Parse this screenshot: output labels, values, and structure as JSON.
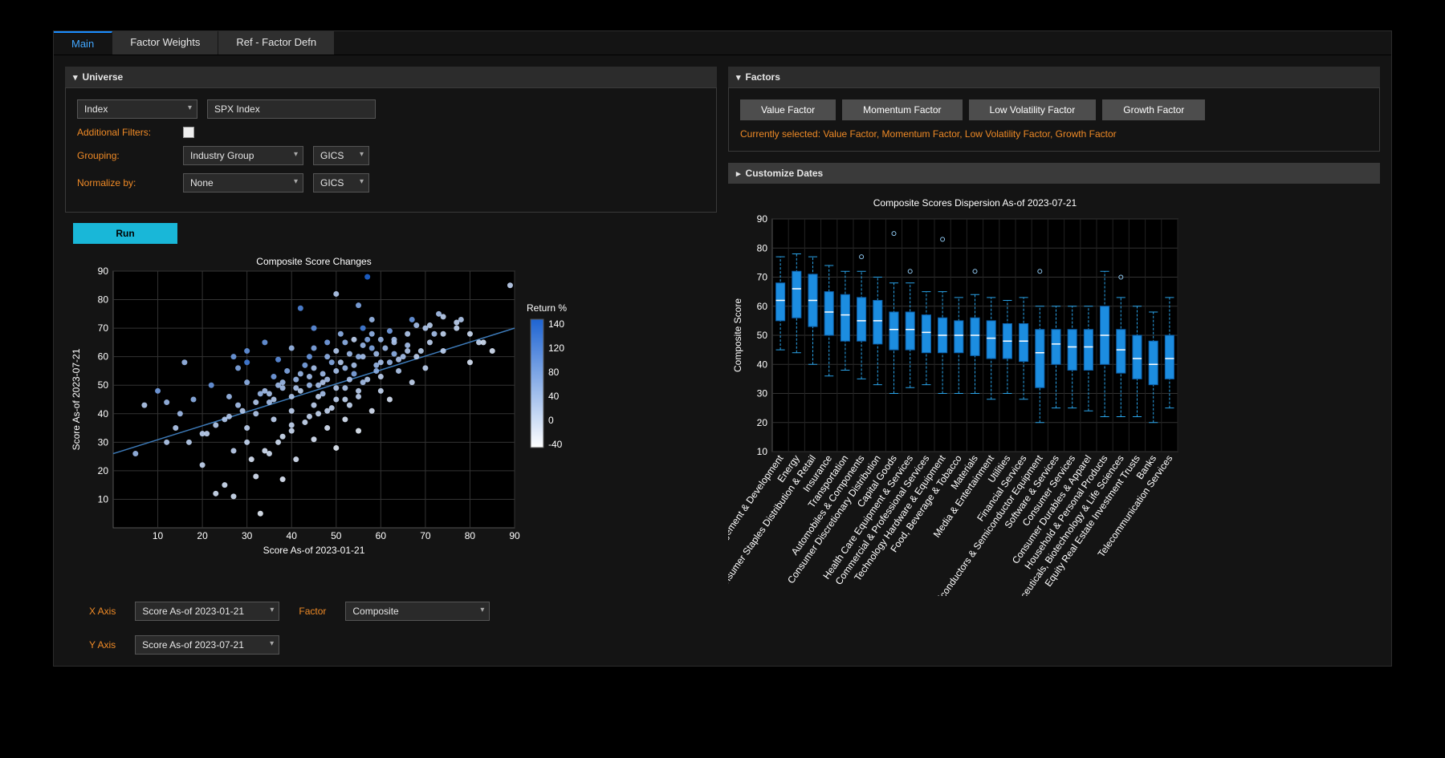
{
  "tabs": [
    "Main",
    "Factor Weights",
    "Ref - Factor Defn"
  ],
  "active_tab": 0,
  "universe": {
    "title": "Universe",
    "index_label": "Index",
    "index_value": "SPX Index",
    "additional_filters_label": "Additional Filters:",
    "grouping_label": "Grouping:",
    "grouping_value": "Industry Group",
    "grouping_system": "GICS",
    "normalize_label": "Normalize by:",
    "normalize_value": "None",
    "normalize_system": "GICS"
  },
  "run_label": "Run",
  "factors": {
    "title": "Factors",
    "buttons": [
      "Value Factor",
      "Momentum Factor",
      "Low Volatility Factor",
      "Growth Factor"
    ],
    "selected_text": "Currently selected: Value Factor, Momentum Factor, Low Volatility Factor, Growth Factor"
  },
  "customize_dates_title": "Customize Dates",
  "axis_controls": {
    "x_label": "X Axis",
    "x_value": "Score As-of 2023-01-21",
    "y_label": "Y Axis",
    "y_value": "Score As-of 2023-07-21",
    "factor_label": "Factor",
    "factor_value": "Composite"
  },
  "chart_data": [
    {
      "type": "scatter",
      "title": "Composite Score Changes",
      "xlabel": "Score As-of 2023-01-21",
      "ylabel": "Score As-of 2023-07-21",
      "xlim": [
        0,
        90
      ],
      "ylim": [
        0,
        90
      ],
      "color_legend_title": "Return %",
      "color_min": -40,
      "color_max": 140,
      "trend_line": [
        [
          0,
          26
        ],
        [
          90,
          70
        ]
      ],
      "points": [
        [
          57,
          88,
          140
        ],
        [
          89,
          85,
          10
        ],
        [
          50,
          82,
          20
        ],
        [
          42,
          77,
          100
        ],
        [
          55,
          78,
          60
        ],
        [
          73,
          75,
          30
        ],
        [
          67,
          73,
          80
        ],
        [
          58,
          73,
          40
        ],
        [
          78,
          73,
          20
        ],
        [
          68,
          71,
          30
        ],
        [
          56,
          70,
          110
        ],
        [
          70,
          70,
          20
        ],
        [
          77,
          72,
          10
        ],
        [
          62,
          69,
          70
        ],
        [
          45,
          70,
          90
        ],
        [
          51,
          68,
          50
        ],
        [
          72,
          68,
          30
        ],
        [
          60,
          66,
          40
        ],
        [
          82,
          65,
          5
        ],
        [
          54,
          66,
          10
        ],
        [
          48,
          65,
          70
        ],
        [
          66,
          64,
          30
        ],
        [
          58,
          63,
          60
        ],
        [
          40,
          63,
          40
        ],
        [
          74,
          62,
          10
        ],
        [
          50,
          62,
          20
        ],
        [
          63,
          61,
          50
        ],
        [
          44,
          60,
          80
        ],
        [
          56,
          60,
          30
        ],
        [
          37,
          59,
          90
        ],
        [
          68,
          60,
          10
        ],
        [
          80,
          58,
          -10
        ],
        [
          30,
          58,
          110
        ],
        [
          16,
          58,
          40
        ],
        [
          51,
          58,
          20
        ],
        [
          59,
          57,
          40
        ],
        [
          45,
          56,
          30
        ],
        [
          70,
          56,
          10
        ],
        [
          64,
          55,
          20
        ],
        [
          28,
          56,
          60
        ],
        [
          54,
          54,
          60
        ],
        [
          42,
          54,
          40
        ],
        [
          60,
          53,
          10
        ],
        [
          36,
          53,
          70
        ],
        [
          48,
          52,
          30
        ],
        [
          67,
          51,
          5
        ],
        [
          56,
          51,
          30
        ],
        [
          30,
          51,
          50
        ],
        [
          22,
          50,
          80
        ],
        [
          44,
          50,
          40
        ],
        [
          52,
          49,
          20
        ],
        [
          38,
          49,
          30
        ],
        [
          60,
          48,
          5
        ],
        [
          47,
          47,
          30
        ],
        [
          33,
          47,
          40
        ],
        [
          55,
          46,
          10
        ],
        [
          40,
          46,
          20
        ],
        [
          26,
          46,
          40
        ],
        [
          50,
          45,
          10
        ],
        [
          62,
          45,
          -10
        ],
        [
          35,
          44,
          30
        ],
        [
          45,
          43,
          10
        ],
        [
          53,
          43,
          5
        ],
        [
          28,
          43,
          30
        ],
        [
          7,
          43,
          20
        ],
        [
          40,
          41,
          10
        ],
        [
          48,
          41,
          5
        ],
        [
          58,
          41,
          -10
        ],
        [
          32,
          40,
          20
        ],
        [
          44,
          39,
          5
        ],
        [
          36,
          38,
          10
        ],
        [
          52,
          38,
          -10
        ],
        [
          25,
          38,
          20
        ],
        [
          40,
          36,
          5
        ],
        [
          48,
          35,
          -10
        ],
        [
          30,
          35,
          10
        ],
        [
          55,
          34,
          -20
        ],
        [
          21,
          33,
          10
        ],
        [
          38,
          32,
          -5
        ],
        [
          45,
          31,
          -10
        ],
        [
          30,
          30,
          5
        ],
        [
          12,
          30,
          20
        ],
        [
          50,
          28,
          -20
        ],
        [
          27,
          27,
          10
        ],
        [
          35,
          26,
          -5
        ],
        [
          5,
          26,
          40
        ],
        [
          41,
          24,
          -10
        ],
        [
          20,
          22,
          5
        ],
        [
          32,
          18,
          -10
        ],
        [
          25,
          15,
          -5
        ],
        [
          38,
          17,
          -15
        ],
        [
          23,
          12,
          -5
        ],
        [
          27,
          11,
          -5
        ],
        [
          33,
          5,
          -20
        ],
        [
          62,
          58,
          40
        ],
        [
          65,
          60,
          30
        ],
        [
          59,
          55,
          50
        ],
        [
          61,
          63,
          35
        ],
        [
          55,
          60,
          45
        ],
        [
          52,
          56,
          40
        ],
        [
          57,
          66,
          60
        ],
        [
          49,
          58,
          55
        ],
        [
          47,
          54,
          35
        ],
        [
          53,
          52,
          25
        ],
        [
          46,
          50,
          30
        ],
        [
          43,
          57,
          65
        ],
        [
          39,
          55,
          60
        ],
        [
          41,
          52,
          40
        ],
        [
          37,
          50,
          35
        ],
        [
          34,
          48,
          30
        ],
        [
          36,
          45,
          20
        ],
        [
          42,
          48,
          15
        ],
        [
          46,
          46,
          10
        ],
        [
          50,
          49,
          18
        ],
        [
          54,
          57,
          28
        ],
        [
          48,
          60,
          48
        ],
        [
          45,
          63,
          60
        ],
        [
          52,
          65,
          50
        ],
        [
          58,
          68,
          45
        ],
        [
          63,
          65,
          25
        ],
        [
          66,
          68,
          20
        ],
        [
          71,
          65,
          10
        ],
        [
          74,
          68,
          8
        ],
        [
          69,
          62,
          15
        ],
        [
          64,
          59,
          25
        ],
        [
          59,
          61,
          35
        ],
        [
          56,
          64,
          40
        ],
        [
          53,
          61,
          38
        ],
        [
          50,
          55,
          28
        ],
        [
          47,
          51,
          22
        ],
        [
          44,
          53,
          32
        ],
        [
          41,
          49,
          24
        ],
        [
          38,
          51,
          36
        ],
        [
          35,
          47,
          26
        ],
        [
          32,
          44,
          20
        ],
        [
          29,
          41,
          18
        ],
        [
          26,
          39,
          22
        ],
        [
          23,
          36,
          16
        ],
        [
          20,
          33,
          14
        ],
        [
          71,
          71,
          15
        ],
        [
          74,
          74,
          12
        ],
        [
          77,
          70,
          5
        ],
        [
          80,
          68,
          0
        ],
        [
          83,
          65,
          -5
        ],
        [
          85,
          62,
          -8
        ],
        [
          10,
          48,
          70
        ],
        [
          12,
          44,
          40
        ],
        [
          15,
          40,
          35
        ],
        [
          18,
          45,
          50
        ],
        [
          14,
          35,
          20
        ],
        [
          17,
          30,
          15
        ],
        [
          30,
          62,
          85
        ],
        [
          34,
          65,
          80
        ],
        [
          27,
          60,
          75
        ],
        [
          63,
          66,
          30
        ],
        [
          66,
          62,
          22
        ],
        [
          60,
          58,
          28
        ],
        [
          57,
          52,
          20
        ],
        [
          55,
          48,
          12
        ],
        [
          52,
          45,
          8
        ],
        [
          49,
          42,
          6
        ],
        [
          46,
          40,
          4
        ],
        [
          43,
          37,
          2
        ],
        [
          40,
          34,
          0
        ],
        [
          37,
          30,
          -5
        ],
        [
          34,
          27,
          -8
        ],
        [
          31,
          24,
          -10
        ]
      ]
    },
    {
      "type": "box",
      "title": "Composite Scores Dispersion As-of 2023-07-21",
      "ylabel": "Composite Score",
      "ylim": [
        10,
        90
      ],
      "yticks": [
        10,
        20,
        30,
        40,
        50,
        60,
        70,
        80,
        90
      ],
      "categories": [
        "Real Estate Management & Development",
        "Energy",
        "Consumer Staples Distribution & Retail",
        "Insurance",
        "Transportation",
        "Automobiles & Components",
        "Consumer Discretionary Distribution",
        "Capital Goods",
        "Health Care Equipment & Services",
        "Commercial & Professional Services",
        "Technology Hardware & Equipment",
        "Food, Beverage & Tobacco",
        "Materials",
        "Media & Entertainment",
        "Utilities",
        "Financial Services",
        "Semiconductors & Semiconductor Equipment",
        "Software & Services",
        "Consumer Services",
        "Consumer Durables & Apparel",
        "Household & Personal Products",
        "Pharmaceuticals, Biotechnology & Life Sciences",
        "Equity Real Estate Investment Trusts",
        "Banks",
        "Telecommunication Services"
      ],
      "boxes": [
        {
          "min": 45,
          "q1": 55,
          "med": 62,
          "q3": 68,
          "max": 77,
          "out": []
        },
        {
          "min": 44,
          "q1": 56,
          "med": 66,
          "q3": 72,
          "max": 78,
          "out": []
        },
        {
          "min": 40,
          "q1": 53,
          "med": 62,
          "q3": 71,
          "max": 77,
          "out": []
        },
        {
          "min": 36,
          "q1": 50,
          "med": 58,
          "q3": 65,
          "max": 74,
          "out": []
        },
        {
          "min": 38,
          "q1": 48,
          "med": 57,
          "q3": 64,
          "max": 72,
          "out": []
        },
        {
          "min": 35,
          "q1": 48,
          "med": 55,
          "q3": 63,
          "max": 72,
          "out": [
            77
          ]
        },
        {
          "min": 33,
          "q1": 47,
          "med": 55,
          "q3": 62,
          "max": 70,
          "out": []
        },
        {
          "min": 30,
          "q1": 45,
          "med": 52,
          "q3": 58,
          "max": 68,
          "out": [
            85
          ]
        },
        {
          "min": 32,
          "q1": 45,
          "med": 52,
          "q3": 58,
          "max": 68,
          "out": [
            72
          ]
        },
        {
          "min": 33,
          "q1": 44,
          "med": 51,
          "q3": 57,
          "max": 65,
          "out": []
        },
        {
          "min": 30,
          "q1": 44,
          "med": 50,
          "q3": 56,
          "max": 65,
          "out": [
            83
          ]
        },
        {
          "min": 30,
          "q1": 44,
          "med": 50,
          "q3": 55,
          "max": 63,
          "out": []
        },
        {
          "min": 30,
          "q1": 43,
          "med": 50,
          "q3": 56,
          "max": 64,
          "out": [
            72
          ]
        },
        {
          "min": 28,
          "q1": 42,
          "med": 49,
          "q3": 55,
          "max": 63,
          "out": []
        },
        {
          "min": 30,
          "q1": 42,
          "med": 48,
          "q3": 54,
          "max": 62,
          "out": []
        },
        {
          "min": 28,
          "q1": 41,
          "med": 48,
          "q3": 54,
          "max": 63,
          "out": []
        },
        {
          "min": 20,
          "q1": 32,
          "med": 44,
          "q3": 52,
          "max": 60,
          "out": [
            72
          ]
        },
        {
          "min": 25,
          "q1": 40,
          "med": 47,
          "q3": 52,
          "max": 60,
          "out": []
        },
        {
          "min": 25,
          "q1": 38,
          "med": 46,
          "q3": 52,
          "max": 60,
          "out": []
        },
        {
          "min": 24,
          "q1": 38,
          "med": 46,
          "q3": 52,
          "max": 60,
          "out": []
        },
        {
          "min": 22,
          "q1": 40,
          "med": 50,
          "q3": 60,
          "max": 72,
          "out": []
        },
        {
          "min": 22,
          "q1": 37,
          "med": 45,
          "q3": 52,
          "max": 63,
          "out": [
            70
          ]
        },
        {
          "min": 22,
          "q1": 35,
          "med": 42,
          "q3": 50,
          "max": 60,
          "out": []
        },
        {
          "min": 20,
          "q1": 33,
          "med": 40,
          "q3": 48,
          "max": 58,
          "out": []
        },
        {
          "min": 25,
          "q1": 35,
          "med": 42,
          "q3": 50,
          "max": 63,
          "out": []
        }
      ]
    }
  ]
}
